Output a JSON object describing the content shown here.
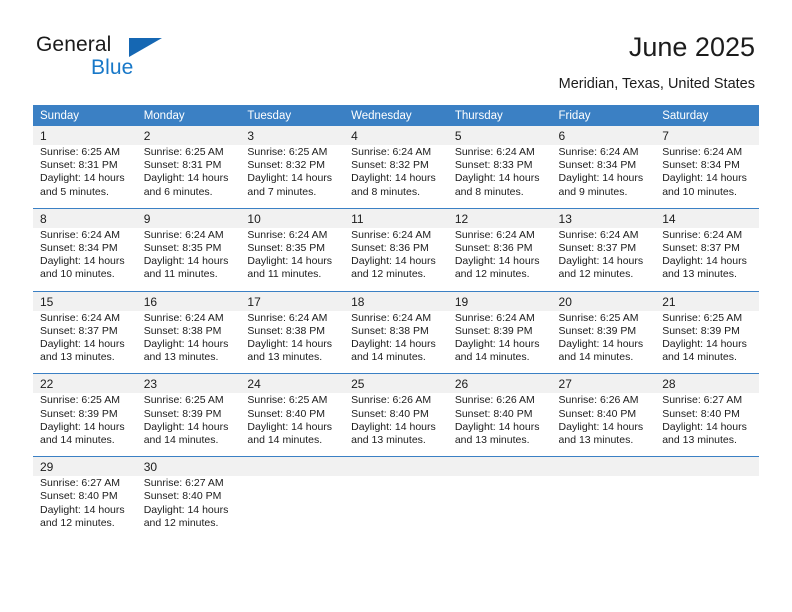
{
  "brand": {
    "name_top": "General",
    "name_bottom": "Blue",
    "triangle_icon": "triangle-icon",
    "accent_color": "#1878c8"
  },
  "header": {
    "title": "June 2025",
    "location": "Meridian, Texas, United States"
  },
  "calendar": {
    "header_bg": "#3b80c4",
    "band_bg": "#f1f1f1",
    "weekday_headers": [
      "Sunday",
      "Monday",
      "Tuesday",
      "Wednesday",
      "Thursday",
      "Friday",
      "Saturday"
    ],
    "weeks": [
      {
        "days": [
          {
            "num": "1",
            "sunrise": "Sunrise: 6:25 AM",
            "sunset": "Sunset: 8:31 PM",
            "daylight1": "Daylight: 14 hours",
            "daylight2": "and 5 minutes."
          },
          {
            "num": "2",
            "sunrise": "Sunrise: 6:25 AM",
            "sunset": "Sunset: 8:31 PM",
            "daylight1": "Daylight: 14 hours",
            "daylight2": "and 6 minutes."
          },
          {
            "num": "3",
            "sunrise": "Sunrise: 6:25 AM",
            "sunset": "Sunset: 8:32 PM",
            "daylight1": "Daylight: 14 hours",
            "daylight2": "and 7 minutes."
          },
          {
            "num": "4",
            "sunrise": "Sunrise: 6:24 AM",
            "sunset": "Sunset: 8:32 PM",
            "daylight1": "Daylight: 14 hours",
            "daylight2": "and 8 minutes."
          },
          {
            "num": "5",
            "sunrise": "Sunrise: 6:24 AM",
            "sunset": "Sunset: 8:33 PM",
            "daylight1": "Daylight: 14 hours",
            "daylight2": "and 8 minutes."
          },
          {
            "num": "6",
            "sunrise": "Sunrise: 6:24 AM",
            "sunset": "Sunset: 8:34 PM",
            "daylight1": "Daylight: 14 hours",
            "daylight2": "and 9 minutes."
          },
          {
            "num": "7",
            "sunrise": "Sunrise: 6:24 AM",
            "sunset": "Sunset: 8:34 PM",
            "daylight1": "Daylight: 14 hours",
            "daylight2": "and 10 minutes."
          }
        ]
      },
      {
        "days": [
          {
            "num": "8",
            "sunrise": "Sunrise: 6:24 AM",
            "sunset": "Sunset: 8:34 PM",
            "daylight1": "Daylight: 14 hours",
            "daylight2": "and 10 minutes."
          },
          {
            "num": "9",
            "sunrise": "Sunrise: 6:24 AM",
            "sunset": "Sunset: 8:35 PM",
            "daylight1": "Daylight: 14 hours",
            "daylight2": "and 11 minutes."
          },
          {
            "num": "10",
            "sunrise": "Sunrise: 6:24 AM",
            "sunset": "Sunset: 8:35 PM",
            "daylight1": "Daylight: 14 hours",
            "daylight2": "and 11 minutes."
          },
          {
            "num": "11",
            "sunrise": "Sunrise: 6:24 AM",
            "sunset": "Sunset: 8:36 PM",
            "daylight1": "Daylight: 14 hours",
            "daylight2": "and 12 minutes."
          },
          {
            "num": "12",
            "sunrise": "Sunrise: 6:24 AM",
            "sunset": "Sunset: 8:36 PM",
            "daylight1": "Daylight: 14 hours",
            "daylight2": "and 12 minutes."
          },
          {
            "num": "13",
            "sunrise": "Sunrise: 6:24 AM",
            "sunset": "Sunset: 8:37 PM",
            "daylight1": "Daylight: 14 hours",
            "daylight2": "and 12 minutes."
          },
          {
            "num": "14",
            "sunrise": "Sunrise: 6:24 AM",
            "sunset": "Sunset: 8:37 PM",
            "daylight1": "Daylight: 14 hours",
            "daylight2": "and 13 minutes."
          }
        ]
      },
      {
        "days": [
          {
            "num": "15",
            "sunrise": "Sunrise: 6:24 AM",
            "sunset": "Sunset: 8:37 PM",
            "daylight1": "Daylight: 14 hours",
            "daylight2": "and 13 minutes."
          },
          {
            "num": "16",
            "sunrise": "Sunrise: 6:24 AM",
            "sunset": "Sunset: 8:38 PM",
            "daylight1": "Daylight: 14 hours",
            "daylight2": "and 13 minutes."
          },
          {
            "num": "17",
            "sunrise": "Sunrise: 6:24 AM",
            "sunset": "Sunset: 8:38 PM",
            "daylight1": "Daylight: 14 hours",
            "daylight2": "and 13 minutes."
          },
          {
            "num": "18",
            "sunrise": "Sunrise: 6:24 AM",
            "sunset": "Sunset: 8:38 PM",
            "daylight1": "Daylight: 14 hours",
            "daylight2": "and 14 minutes."
          },
          {
            "num": "19",
            "sunrise": "Sunrise: 6:24 AM",
            "sunset": "Sunset: 8:39 PM",
            "daylight1": "Daylight: 14 hours",
            "daylight2": "and 14 minutes."
          },
          {
            "num": "20",
            "sunrise": "Sunrise: 6:25 AM",
            "sunset": "Sunset: 8:39 PM",
            "daylight1": "Daylight: 14 hours",
            "daylight2": "and 14 minutes."
          },
          {
            "num": "21",
            "sunrise": "Sunrise: 6:25 AM",
            "sunset": "Sunset: 8:39 PM",
            "daylight1": "Daylight: 14 hours",
            "daylight2": "and 14 minutes."
          }
        ]
      },
      {
        "days": [
          {
            "num": "22",
            "sunrise": "Sunrise: 6:25 AM",
            "sunset": "Sunset: 8:39 PM",
            "daylight1": "Daylight: 14 hours",
            "daylight2": "and 14 minutes."
          },
          {
            "num": "23",
            "sunrise": "Sunrise: 6:25 AM",
            "sunset": "Sunset: 8:39 PM",
            "daylight1": "Daylight: 14 hours",
            "daylight2": "and 14 minutes."
          },
          {
            "num": "24",
            "sunrise": "Sunrise: 6:25 AM",
            "sunset": "Sunset: 8:40 PM",
            "daylight1": "Daylight: 14 hours",
            "daylight2": "and 14 minutes."
          },
          {
            "num": "25",
            "sunrise": "Sunrise: 6:26 AM",
            "sunset": "Sunset: 8:40 PM",
            "daylight1": "Daylight: 14 hours",
            "daylight2": "and 13 minutes."
          },
          {
            "num": "26",
            "sunrise": "Sunrise: 6:26 AM",
            "sunset": "Sunset: 8:40 PM",
            "daylight1": "Daylight: 14 hours",
            "daylight2": "and 13 minutes."
          },
          {
            "num": "27",
            "sunrise": "Sunrise: 6:26 AM",
            "sunset": "Sunset: 8:40 PM",
            "daylight1": "Daylight: 14 hours",
            "daylight2": "and 13 minutes."
          },
          {
            "num": "28",
            "sunrise": "Sunrise: 6:27 AM",
            "sunset": "Sunset: 8:40 PM",
            "daylight1": "Daylight: 14 hours",
            "daylight2": "and 13 minutes."
          }
        ]
      },
      {
        "days": [
          {
            "num": "29",
            "sunrise": "Sunrise: 6:27 AM",
            "sunset": "Sunset: 8:40 PM",
            "daylight1": "Daylight: 14 hours",
            "daylight2": "and 12 minutes."
          },
          {
            "num": "30",
            "sunrise": "Sunrise: 6:27 AM",
            "sunset": "Sunset: 8:40 PM",
            "daylight1": "Daylight: 14 hours",
            "daylight2": "and 12 minutes."
          },
          {
            "num": "",
            "sunrise": "",
            "sunset": "",
            "daylight1": "",
            "daylight2": ""
          },
          {
            "num": "",
            "sunrise": "",
            "sunset": "",
            "daylight1": "",
            "daylight2": ""
          },
          {
            "num": "",
            "sunrise": "",
            "sunset": "",
            "daylight1": "",
            "daylight2": ""
          },
          {
            "num": "",
            "sunrise": "",
            "sunset": "",
            "daylight1": "",
            "daylight2": ""
          },
          {
            "num": "",
            "sunrise": "",
            "sunset": "",
            "daylight1": "",
            "daylight2": ""
          }
        ]
      }
    ]
  }
}
